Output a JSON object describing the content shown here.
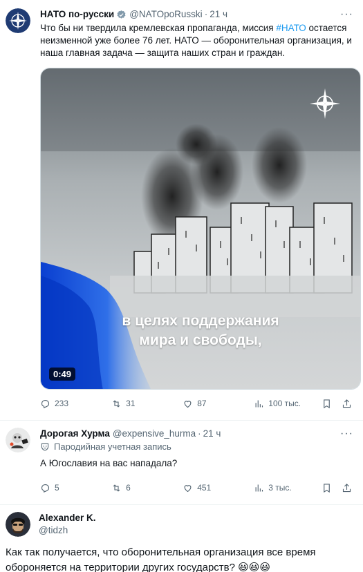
{
  "tweet1": {
    "name": "НАТО по-русски",
    "handle": "@NATOpoRusski",
    "time": "21 ч",
    "text_before": "Что бы ни твердила кремлевская пропаганда, миссия ",
    "hashtag": "#НАТО",
    "text_after": " остается неизменной уже более 76 лет. НАТО — оборонительная организация, и наша главная задача — защита наших стран и граждан.",
    "video": {
      "caption_line1": "в целях поддержания",
      "caption_line2": "мира и свободы,",
      "duration": "0:49"
    },
    "replies": "233",
    "reposts": "31",
    "likes": "87",
    "views": "100 тыс."
  },
  "tweet2": {
    "name": "Дорогая Хурма",
    "handle": "@expensive_hurma",
    "time": "21 ч",
    "parody_label": "Пародийная учетная запись",
    "text": "А Югославия на вас нападала?",
    "replies": "5",
    "reposts": "6",
    "likes": "451",
    "views": "3 тыс."
  },
  "tweet3": {
    "name": "Alexander K.",
    "handle": "@tidzh",
    "text": "Как так получается, что оборонительная организация все время обороняется на территории других государств? 😃😃😃"
  },
  "colors": {
    "accent": "#1d9bf0",
    "muted": "#536471",
    "verified": "#1d9bf0"
  },
  "icons": [
    "nato-compass-icon",
    "verified-badge-icon",
    "more-icon",
    "reply-icon",
    "repost-icon",
    "like-icon",
    "views-icon",
    "bookmark-icon",
    "share-icon",
    "parody-mask-icon"
  ]
}
